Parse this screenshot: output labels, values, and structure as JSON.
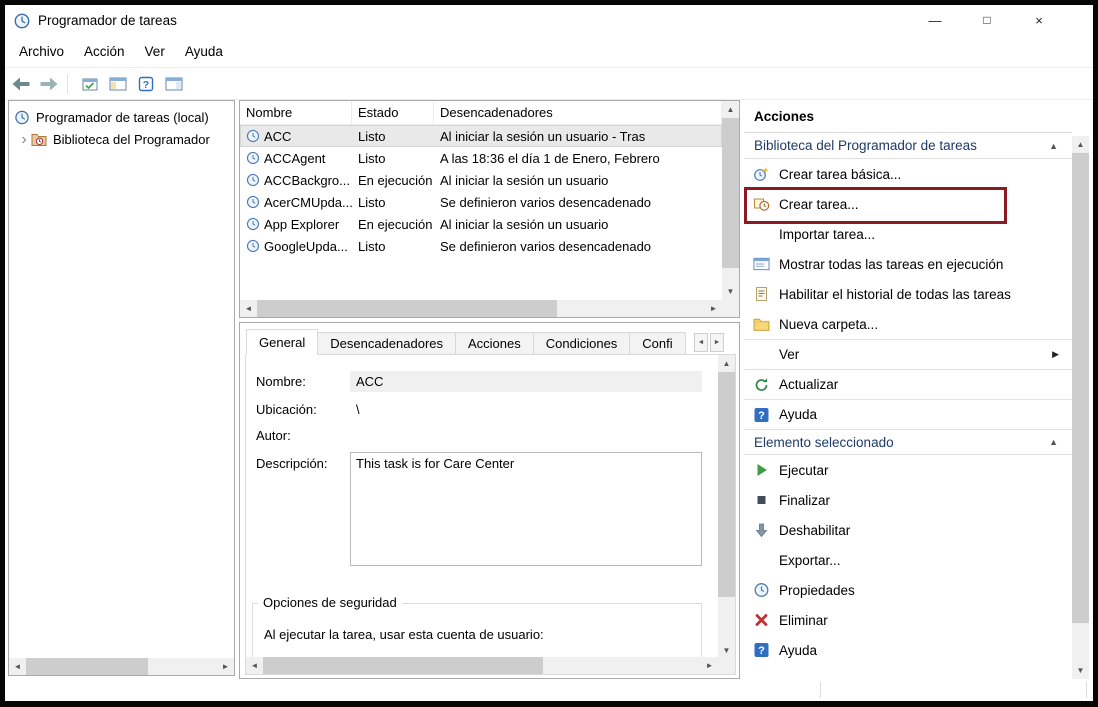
{
  "glyphs": {
    "minimize": "—",
    "maximize": "□",
    "close": "×",
    "up": "▲",
    "down": "▼",
    "left": "◄",
    "right": "►",
    "collapse": "▲",
    "submenu": "▶",
    "tree_expand": "›"
  },
  "window": {
    "title": "Programador de tareas"
  },
  "menu": {
    "items": [
      "Archivo",
      "Acción",
      "Ver",
      "Ayuda"
    ]
  },
  "tree": {
    "root": "Programador de tareas (local)",
    "child": "Biblioteca del Programador"
  },
  "tasks": {
    "columns": [
      "Nombre",
      "Estado",
      "Desencadenadores"
    ],
    "rows": [
      {
        "name": "ACC",
        "status": "Listo",
        "trigger": "Al iniciar la sesión un usuario - Tras"
      },
      {
        "name": "ACCAgent",
        "status": "Listo",
        "trigger": "A las 18:36 el día 1 de Enero, Febrero"
      },
      {
        "name": "ACCBackgro...",
        "status": "En ejecución",
        "trigger": "Al iniciar la sesión un usuario"
      },
      {
        "name": "AcerCMUpda...",
        "status": "Listo",
        "trigger": "Se definieron varios desencadenado"
      },
      {
        "name": "App Explorer",
        "status": "En ejecución",
        "trigger": "Al iniciar la sesión un usuario"
      },
      {
        "name": "GoogleUpda...",
        "status": "Listo",
        "trigger": "Se definieron varios desencadenado"
      }
    ]
  },
  "details": {
    "tabs": [
      "General",
      "Desencadenadores",
      "Acciones",
      "Condiciones",
      "Confi"
    ],
    "fields": {
      "name_label": "Nombre:",
      "name_value": "ACC",
      "location_label": "Ubicación:",
      "location_value": "\\",
      "author_label": "Autor:",
      "description_label": "Descripción:",
      "description_value": "This task is for Care Center"
    },
    "security_group": "Opciones de seguridad",
    "security_text": "Al ejecutar la tarea, usar esta cuenta de usuario:"
  },
  "actions": {
    "title": "Acciones",
    "scope_section": {
      "header": "Biblioteca del Programador de tareas",
      "items": [
        {
          "label": "Crear tarea básica...",
          "icon": "create-basic-task-icon"
        },
        {
          "label": "Crear tarea...",
          "icon": "create-task-icon"
        },
        {
          "label": "Importar tarea...",
          "icon": ""
        },
        {
          "label": "Mostrar todas las tareas en ejecución",
          "icon": "running-tasks-icon"
        },
        {
          "label": "Habilitar el historial de todas las tareas",
          "icon": "history-icon"
        },
        {
          "label": "Nueva carpeta...",
          "icon": "new-folder-icon"
        },
        {
          "label": "Ver",
          "icon": ""
        },
        {
          "label": "Actualizar",
          "icon": "refresh-icon"
        },
        {
          "label": "Ayuda",
          "icon": "help-icon"
        }
      ]
    },
    "item_section": {
      "header": "Elemento seleccionado",
      "items": [
        {
          "label": "Ejecutar",
          "icon": "run-icon"
        },
        {
          "label": "Finalizar",
          "icon": "stop-icon"
        },
        {
          "label": "Deshabilitar",
          "icon": "disable-icon"
        },
        {
          "label": "Exportar...",
          "icon": ""
        },
        {
          "label": "Propiedades",
          "icon": "properties-icon"
        },
        {
          "label": "Eliminar",
          "icon": "delete-icon"
        },
        {
          "label": "Ayuda",
          "icon": "help-icon"
        }
      ]
    }
  },
  "annotation": {
    "highlight_color": "#8b1a22",
    "highlighted_item": "Crear tarea..."
  }
}
